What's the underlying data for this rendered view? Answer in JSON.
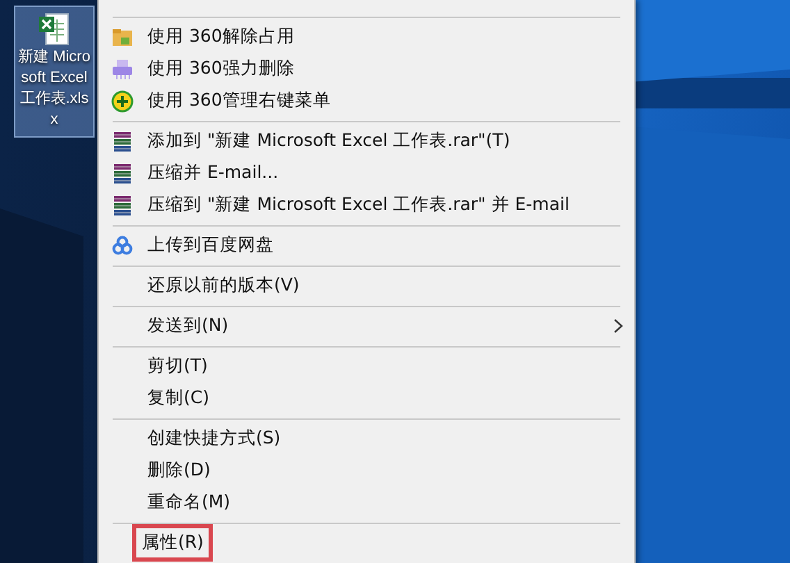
{
  "desktop_icon": {
    "label": "新建 Microsoft Excel 工作表.xlsx",
    "selected": true
  },
  "context_menu": {
    "groups": [
      [
        {
          "label": "使用 360解除占用",
          "kind": "unlock"
        },
        {
          "label": "使用 360强力删除",
          "kind": "shred"
        },
        {
          "label": "使用 360管理右键菜单",
          "kind": "manage"
        }
      ],
      [
        {
          "label": "添加到 \"新建 Microsoft Excel 工作表.rar\"(T)",
          "kind": "archive"
        },
        {
          "label": "压缩并 E-mail...",
          "kind": "archive"
        },
        {
          "label": "压缩到 \"新建 Microsoft Excel 工作表.rar\" 并 E-mail",
          "kind": "archive"
        }
      ],
      [
        {
          "label": "上传到百度网盘",
          "kind": "cloud"
        }
      ],
      [
        {
          "label": "还原以前的版本(V)",
          "kind": "plain"
        }
      ],
      [
        {
          "label": "发送到(N)",
          "kind": "plain",
          "submenu": true
        }
      ],
      [
        {
          "label": "剪切(T)",
          "kind": "plain"
        },
        {
          "label": "复制(C)",
          "kind": "plain"
        }
      ],
      [
        {
          "label": "创建快捷方式(S)",
          "kind": "plain"
        },
        {
          "label": "删除(D)",
          "kind": "plain"
        },
        {
          "label": "重命名(M)",
          "kind": "plain"
        }
      ],
      [
        {
          "label": "属性(R)",
          "kind": "plain",
          "outlined": true
        }
      ]
    ]
  }
}
